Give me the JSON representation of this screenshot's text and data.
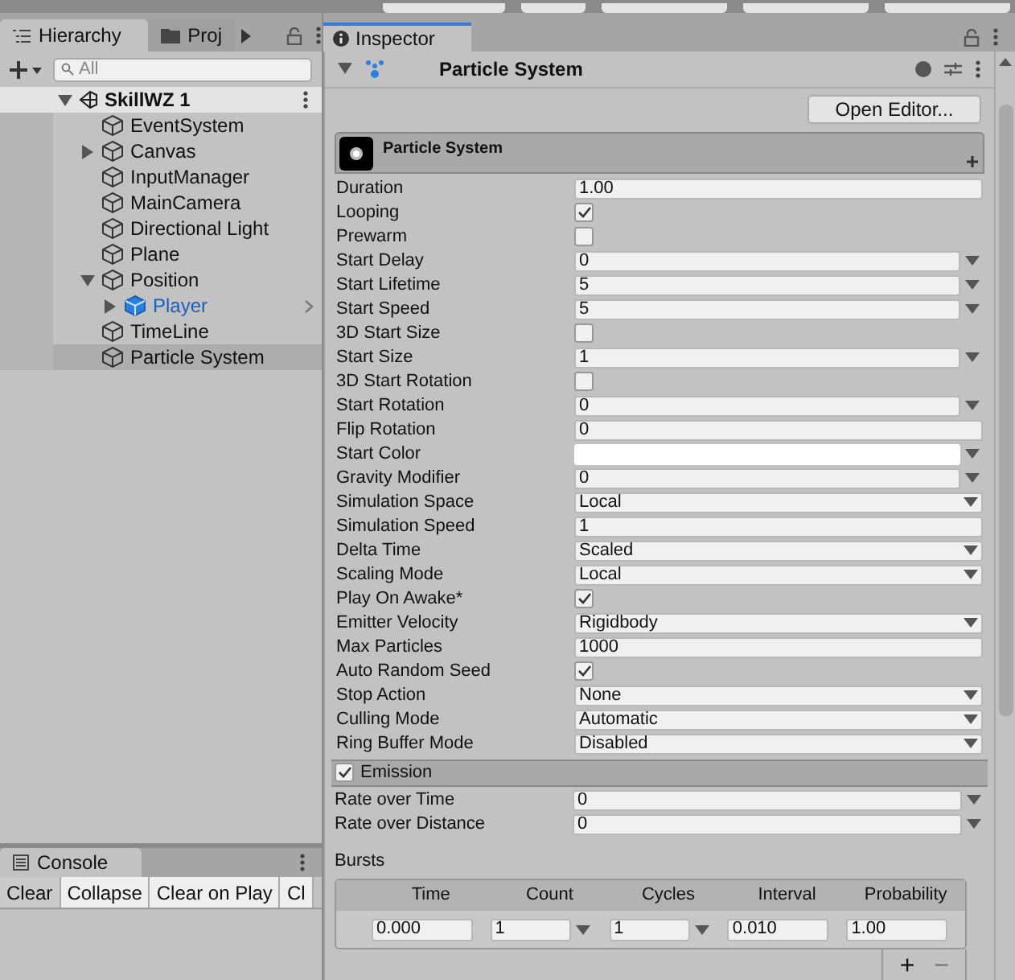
{
  "hierarchy": {
    "tabs": [
      {
        "label": "Hierarchy",
        "selected": true
      },
      {
        "label": "Proj",
        "selected": false
      }
    ],
    "search": {
      "placeholder": "All"
    },
    "scene": {
      "name": "SkillWZ 1",
      "expanded": true
    },
    "items": [
      {
        "name": "EventSystem",
        "kind": "object",
        "selected": false
      },
      {
        "name": "Canvas",
        "kind": "object",
        "selected": false,
        "expanded": false
      },
      {
        "name": "InputManager",
        "kind": "object",
        "selected": false
      },
      {
        "name": "MainCamera",
        "kind": "object",
        "selected": false
      },
      {
        "name": "Directional Light",
        "kind": "object",
        "selected": false
      },
      {
        "name": "Plane",
        "kind": "object",
        "selected": false
      },
      {
        "name": "Position",
        "kind": "object",
        "selected": false,
        "expanded": true,
        "children": [
          {
            "name": "Player",
            "kind": "prefab",
            "selected": false,
            "expanded": false
          }
        ]
      },
      {
        "name": "TimeLine",
        "kind": "object",
        "selected": false
      },
      {
        "name": "Particle System",
        "kind": "object",
        "selected": true
      }
    ]
  },
  "console": {
    "tab": "Console",
    "buttons": [
      {
        "label": "Clear",
        "kind": "action"
      },
      {
        "label": "Collapse",
        "kind": "toggle"
      },
      {
        "label": "Clear on Play",
        "kind": "toggle"
      },
      {
        "label": "Cl",
        "kind": "toggle"
      }
    ]
  },
  "inspector": {
    "tab": "Inspector",
    "component": "Particle System",
    "open_editor": "Open Editor...",
    "module": "Particle System",
    "fields": [
      {
        "label": "Duration",
        "kind": "text",
        "value": "1.00"
      },
      {
        "label": "Looping",
        "kind": "check",
        "checked": true
      },
      {
        "label": "Prewarm",
        "kind": "check",
        "checked": false
      },
      {
        "label": "Start Delay",
        "kind": "curve",
        "value": "0"
      },
      {
        "label": "Start Lifetime",
        "kind": "curve",
        "value": "5"
      },
      {
        "label": "Start Speed",
        "kind": "curve",
        "value": "5"
      },
      {
        "label": "3D Start Size",
        "kind": "check",
        "checked": false
      },
      {
        "label": "Start Size",
        "kind": "curve",
        "value": "1"
      },
      {
        "label": "3D Start Rotation",
        "kind": "check",
        "checked": false
      },
      {
        "label": "Start Rotation",
        "kind": "curve",
        "value": "0"
      },
      {
        "label": "Flip Rotation",
        "kind": "text",
        "value": "0"
      },
      {
        "label": "Start Color",
        "kind": "color",
        "color": "#ffffff"
      },
      {
        "label": "Gravity Modifier",
        "kind": "curve",
        "value": "0"
      },
      {
        "label": "Simulation Space",
        "kind": "select",
        "value": "Local"
      },
      {
        "label": "Simulation Speed",
        "kind": "text",
        "value": "1"
      },
      {
        "label": "Delta Time",
        "kind": "select",
        "value": "Scaled"
      },
      {
        "label": "Scaling Mode",
        "kind": "select",
        "value": "Local"
      },
      {
        "label": "Play On Awake*",
        "kind": "check",
        "checked": true
      },
      {
        "label": "Emitter Velocity",
        "kind": "select",
        "value": "Rigidbody"
      },
      {
        "label": "Max Particles",
        "kind": "text",
        "value": "1000"
      },
      {
        "label": "Auto Random Seed",
        "kind": "check",
        "checked": true
      },
      {
        "label": "Stop Action",
        "kind": "select",
        "value": "None"
      },
      {
        "label": "Culling Mode",
        "kind": "select",
        "value": "Automatic"
      },
      {
        "label": "Ring Buffer Mode",
        "kind": "select",
        "value": "Disabled"
      }
    ],
    "emission": {
      "label": "Emission",
      "checked": true,
      "fields": [
        {
          "label": "Rate over Time",
          "kind": "curve",
          "value": "0"
        },
        {
          "label": "Rate over Distance",
          "kind": "curve",
          "value": "0"
        }
      ],
      "bursts": {
        "label": "Bursts",
        "columns": [
          "Time",
          "Count",
          "Cycles",
          "Interval",
          "Probability"
        ],
        "rows": [
          [
            {
              "value": "0.000",
              "kind": "text"
            },
            {
              "value": "1",
              "kind": "curve"
            },
            {
              "value": "1",
              "kind": "curve"
            },
            {
              "value": "0.010",
              "kind": "text"
            },
            {
              "value": "1.00",
              "kind": "text"
            }
          ]
        ],
        "add": "+",
        "remove": "−"
      }
    }
  }
}
